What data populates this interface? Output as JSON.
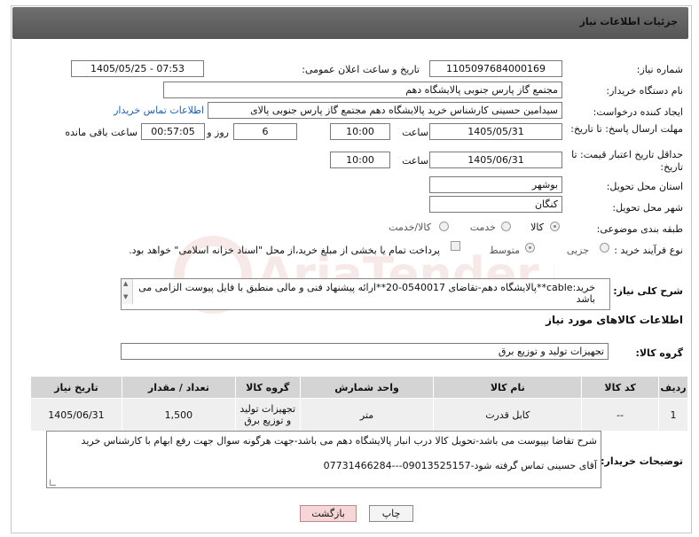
{
  "header": {
    "title": "جزئیات اطلاعات نیاز"
  },
  "fields": {
    "need_number_label": "شماره نیاز:",
    "need_number": "1105097684000169",
    "announce_label": "تاریخ و ساعت اعلان عمومی:",
    "announce_value": "1405/05/25 - 07:53",
    "buyer_org_label": "نام دستگاه خریدار:",
    "buyer_org": "مجتمع گاز پارس جنوبی  پالایشگاه دهم",
    "requester_label": "ایجاد کننده درخواست:",
    "requester": "سیدامین حسینی کارشناس خرید پالایشگاه دهم  مجتمع گاز پارس جنوبی  پالای",
    "buyer_contact_link": "اطلاعات تماس خریدار",
    "reply_deadline_label": "مهلت ارسال پاسخ: تا تاریخ:",
    "reply_date": "1405/05/31",
    "time_label": "ساعت",
    "reply_time": "10:00",
    "days_value": "6",
    "days_label": "روز و",
    "remaining_time": "00:57:05",
    "remaining_label": "ساعت باقی مانده",
    "price_validity_label": "حداقل تاریخ اعتبار قیمت: تا تاریخ:",
    "price_date": "1405/06/31",
    "price_time": "10:00",
    "province_label": "استان محل تحویل:",
    "province": "بوشهر",
    "city_label": "شهر محل تحویل:",
    "city": "کنگان",
    "category_label": "طبقه بندی موضوعی:",
    "category_options": [
      "کالا",
      "خدمت",
      "کالا/خدمت"
    ],
    "process_label": "نوع فرآیند خرید :",
    "process_options": [
      "جزیی",
      "متوسط"
    ],
    "payment_note": "پرداخت تمام یا بخشی از مبلغ خرید،از محل \"اسناد خزانه اسلامی\" خواهد بود."
  },
  "description": {
    "label": "شرح کلی نیاز:",
    "text": "خرید:cable**پالایشگاه دهم-تقاضای 0540017-20**ارائه پیشنهاد فنی و مالی منطبق با فایل پیوست الزامی می باشد"
  },
  "goods_info_title": "اطلاعات کالاهای مورد نیاز",
  "goods_group": {
    "label": "گروه کالا:",
    "value": "تجهیزات تولید و توزیع برق"
  },
  "table": {
    "headers": [
      "ردیف",
      "کد کالا",
      "نام کالا",
      "واحد شمارش",
      "گروه کالا",
      "تعداد / مقدار",
      "تاریخ نیاز"
    ],
    "rows": [
      [
        "1",
        "--",
        "کابل قدرت",
        "متر",
        "تجهیزات تولید و توزیع برق",
        "1,500",
        "1405/06/31"
      ]
    ]
  },
  "buyer_notes": {
    "label": "توضیحات خریدار:",
    "line1": "شرح تقاضا بپیوست می باشد-تحویل کالا درب انبار پالایشگاه دهم می باشد-جهت هرگونه سوال جهت رفع ابهام با کارشناس خرید",
    "line2": "آقای حسینی تماس گرفته شود-09013525157---07731466284"
  },
  "buttons": {
    "print": "چاپ",
    "back": "بازگشت"
  },
  "watermark_text": "AriaTender.neT",
  "colors": {
    "title_bar": "#5f5f5f",
    "link": "#1a5fb4",
    "back_button_bg": "#f6d6d6"
  }
}
